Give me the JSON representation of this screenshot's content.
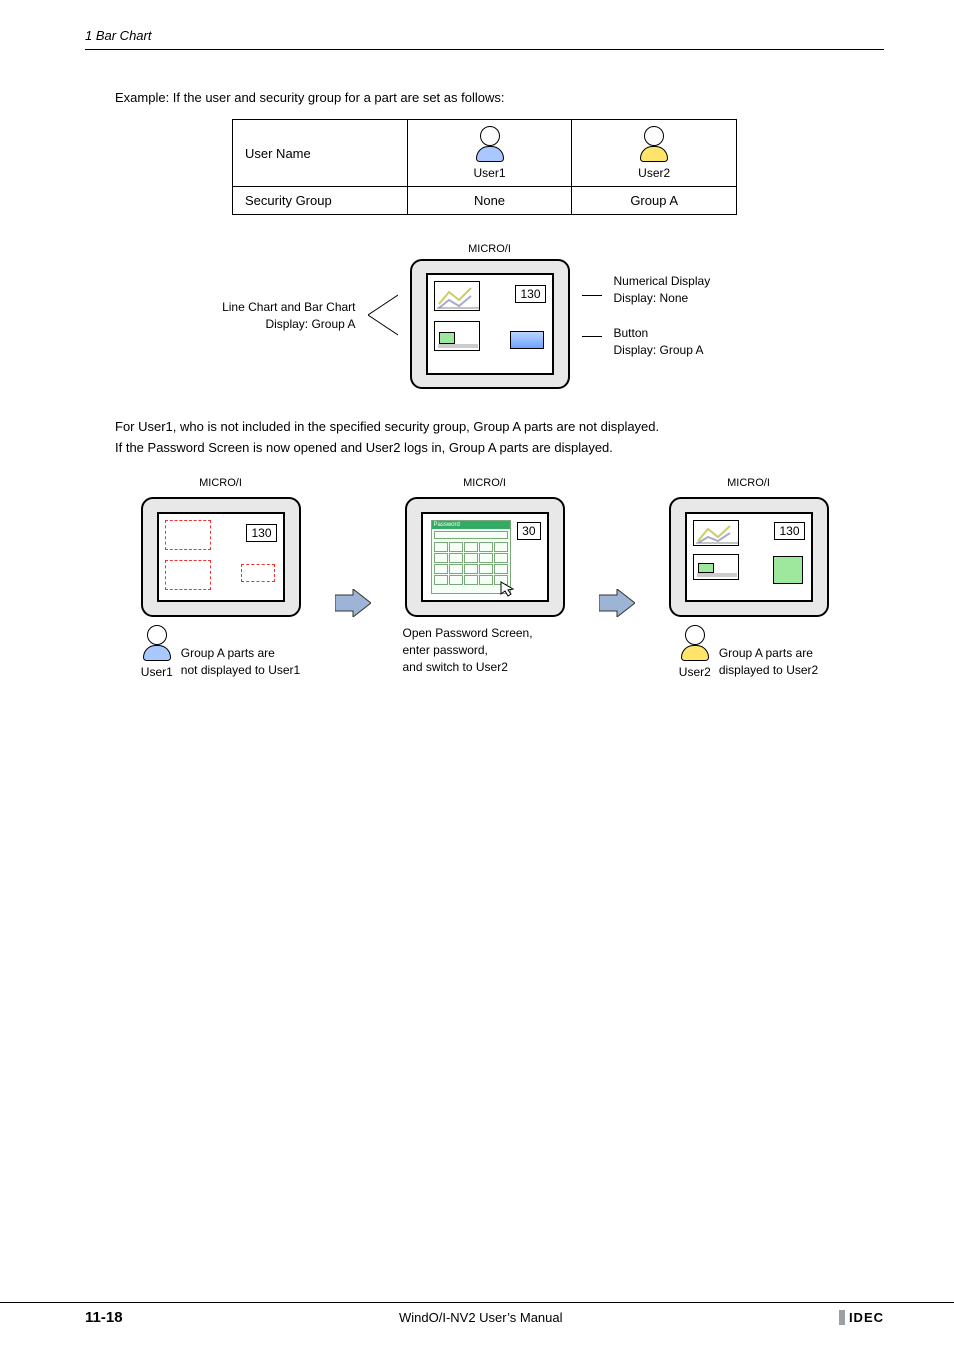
{
  "header": {
    "running": "1 Bar Chart"
  },
  "intro": "Example: If the user and security group for a part are set as follows:",
  "table": {
    "rows": [
      {
        "label": "User Name",
        "c1": "User1",
        "c2": "User2"
      },
      {
        "label": "Security Group",
        "c1": "None",
        "c2": "Group A"
      }
    ]
  },
  "mainDiagram": {
    "device": "MICRO/I",
    "leftLabel1": "Line Chart and Bar Chart",
    "leftLabel2": "Display: Group A",
    "right1a": "Numerical Display",
    "right1b": "Display: None",
    "right2a": "Button",
    "right2b": "Display: Group A",
    "value": "130"
  },
  "para1": "For User1, who is not included in the specified security group, Group A parts are not displayed.",
  "para2": "If the Password Screen is now opened and User2 logs in, Group A parts are displayed.",
  "seq": {
    "device": "MICRO/I",
    "val1": "130",
    "val2": "30",
    "val3": "130",
    "pwLabel": "Password",
    "cap1a": "Group A parts are",
    "cap1b": "not displayed to User1",
    "user1": "User1",
    "cap2a": "Open Password Screen,",
    "cap2b": "enter password,",
    "cap2c": "and switch to User2",
    "cap3a": "Group A parts are",
    "cap3b": "displayed to User2",
    "user2": "User2"
  },
  "footer": {
    "page": "11-18",
    "manual": "WindO/I-NV2 User’s Manual",
    "brand": "IDEC"
  }
}
